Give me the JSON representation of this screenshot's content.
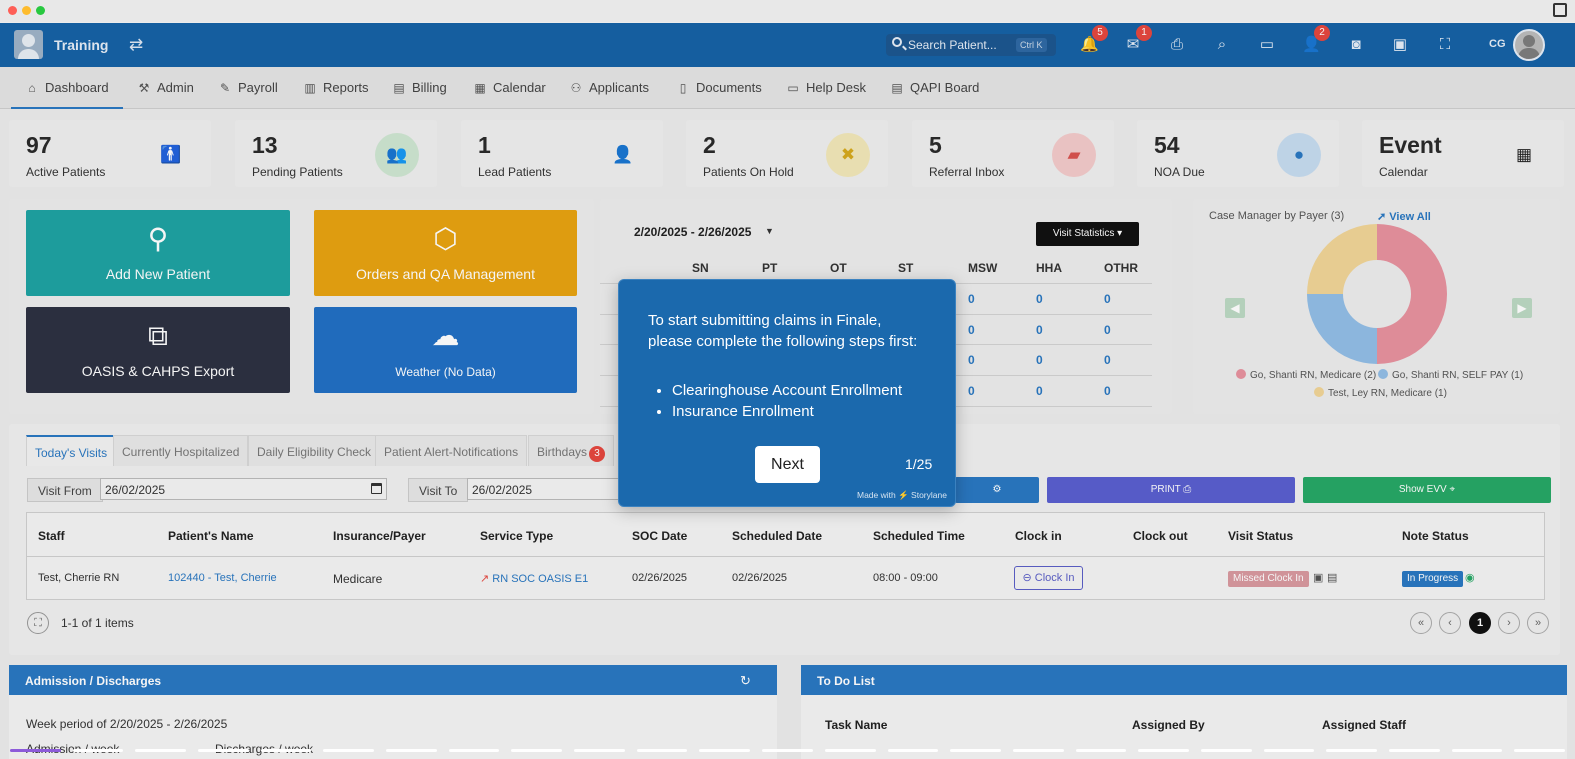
{
  "app": {
    "title": "Training"
  },
  "header": {
    "search_placeholder": "Search Patient...",
    "search_shortcut": "Ctrl K",
    "notifications_badge": "5",
    "messages_badge": "1",
    "users_badge": "2",
    "user_initials": "CG"
  },
  "nav": [
    {
      "label": "Dashboard",
      "icon": "home-icon"
    },
    {
      "label": "Admin",
      "icon": "wrench-icon"
    },
    {
      "label": "Payroll",
      "icon": "edit-icon"
    },
    {
      "label": "Reports",
      "icon": "bar-chart-icon"
    },
    {
      "label": "Billing",
      "icon": "clipboard-icon"
    },
    {
      "label": "Calendar",
      "icon": "calendar-icon"
    },
    {
      "label": "Applicants",
      "icon": "users-icon"
    },
    {
      "label": "Documents",
      "icon": "document-icon"
    },
    {
      "label": "Help Desk",
      "icon": "ticket-icon"
    },
    {
      "label": "QAPI Board",
      "icon": "clipboard-list-icon"
    }
  ],
  "stats": [
    {
      "value": "97",
      "label": "Active Patients"
    },
    {
      "value": "13",
      "label": "Pending Patients"
    },
    {
      "value": "1",
      "label": "Lead Patients"
    },
    {
      "value": "2",
      "label": "Patients On Hold"
    },
    {
      "value": "5",
      "label": "Referral Inbox"
    },
    {
      "value": "54",
      "label": "NOA Due"
    },
    {
      "value": "Event",
      "label": "Calendar"
    }
  ],
  "tiles": [
    {
      "label": "Add New Patient"
    },
    {
      "label": "Orders and QA Management"
    },
    {
      "label": "OASIS & CAHPS Export"
    },
    {
      "label": "Weather (No Data)"
    }
  ],
  "visit_stats": {
    "date_range": "2/20/2025 - 2/26/2025",
    "button": "Visit Statistics ▾",
    "columns": [
      "SN",
      "PT",
      "OT",
      "ST",
      "MSW",
      "HHA",
      "OTHR"
    ],
    "rows": [
      [
        "0",
        "0",
        "0"
      ],
      [
        "0",
        "0",
        "0"
      ],
      [
        "0",
        "0",
        "0"
      ],
      [
        "0",
        "0",
        "0"
      ]
    ]
  },
  "case_manager": {
    "title": "Case Manager by Payer",
    "count": "(3)",
    "view_all": "View All",
    "legend": [
      {
        "label": "Go, Shanti RN, Medicare (2)",
        "color": "#e9a0ad"
      },
      {
        "label": "Go, Shanti RN, SELF PAY  (1)",
        "color": "#9ec6ea"
      },
      {
        "label": "Test, Ley RN, Medicare (1)",
        "color": "#f2dba0"
      }
    ]
  },
  "tabs": [
    {
      "label": "Today's Visits"
    },
    {
      "label": "Currently Hospitalized"
    },
    {
      "label": "Daily Eligibility Check"
    },
    {
      "label": "Patient Alert-Notifications"
    },
    {
      "label": "Birthdays",
      "badge": "3"
    }
  ],
  "filters": {
    "visit_from_label": "Visit From",
    "visit_from_value": "26/02/2025",
    "visit_to_label": "Visit To",
    "visit_to_value": "26/02/2025",
    "print_label": "PRINT",
    "evv_label": "Show EVV"
  },
  "grid": {
    "headers": [
      "Staff",
      "Patient's Name",
      "Insurance/Payer",
      "Service Type",
      "SOC Date",
      "Scheduled Date",
      "Scheduled Time",
      "Clock in",
      "Clock out",
      "Visit Status",
      "Note Status"
    ],
    "row": {
      "staff": "Test, Cherrie RN",
      "patient": "102440 - Test, Cherrie",
      "payer": "Medicare",
      "service": "RN SOC OASIS E1",
      "soc_date": "02/26/2025",
      "scheduled_date": "02/26/2025",
      "scheduled_time": "08:00 - 09:00",
      "clock_in_btn": "Clock In",
      "visit_status": "Missed Clock In",
      "note_status": "In Progress"
    },
    "pager_info": "1-1 of 1 items",
    "current_page": "1"
  },
  "admissions": {
    "title": "Admission / Discharges",
    "week_text": "Week period of 2/20/2025 - 2/26/2025",
    "cut_text_1": "Admission / week",
    "cut_text_2": "Discharges / week"
  },
  "todo": {
    "title": "To Do List",
    "headers": [
      "Task Name",
      "Assigned By",
      "Assigned Staff"
    ]
  },
  "tour": {
    "message": "To start submitting claims in Finale, please complete the following steps first:",
    "steps": [
      "Clearinghouse Account Enrollment",
      "Insurance Enrollment"
    ],
    "next": "Next",
    "progress": "1/25",
    "made_with": "Made with ⚡ Storylane"
  }
}
